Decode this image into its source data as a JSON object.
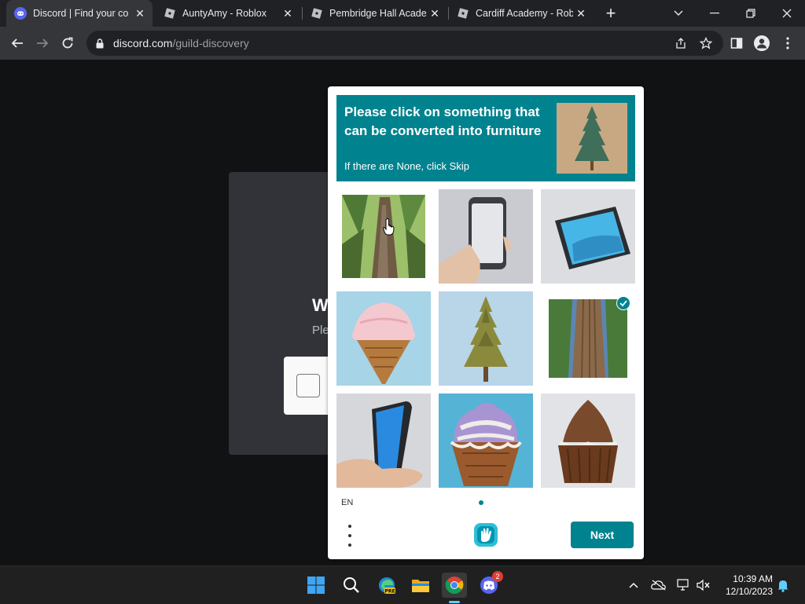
{
  "browser": {
    "tabs": [
      {
        "title": "Discord | Find your co",
        "icon": "discord-icon",
        "active": true
      },
      {
        "title": "AuntyAmy - Roblox",
        "icon": "roblox-icon",
        "active": false
      },
      {
        "title": "Pembridge Hall Acade",
        "icon": "roblox-icon",
        "active": false
      },
      {
        "title": "Cardiff Academy - Rob",
        "icon": "roblox-icon",
        "active": false
      }
    ],
    "new_tab_label": "+",
    "url_domain": "discord.com",
    "url_path": "/guild-discovery"
  },
  "background_page": {
    "heading_fragment": "W",
    "sub_fragment": "Ple"
  },
  "captcha": {
    "prompt": "Please click on something that can be converted into furniture",
    "instruction": "If there are None, click Skip",
    "example_image": "pine-tree",
    "grid": [
      {
        "image": "tree-trunk-looking-up",
        "selected": false
      },
      {
        "image": "phone-in-hand",
        "selected": false
      },
      {
        "image": "tablet-on-table",
        "selected": false
      },
      {
        "image": "ice-cream-cone-pink",
        "selected": false
      },
      {
        "image": "pine-tree",
        "selected": false
      },
      {
        "image": "tree-trunk",
        "selected": true
      },
      {
        "image": "phone-in-hand-blue",
        "selected": false
      },
      {
        "image": "ice-cream-cone-purple",
        "selected": false
      },
      {
        "image": "chocolate-cupcake",
        "selected": false
      }
    ],
    "language": "EN",
    "next_label": "Next",
    "accent_color": "#00838f"
  },
  "taskbar": {
    "discord_badge": "2",
    "time": "10:39 AM",
    "date": "12/10/2023"
  }
}
